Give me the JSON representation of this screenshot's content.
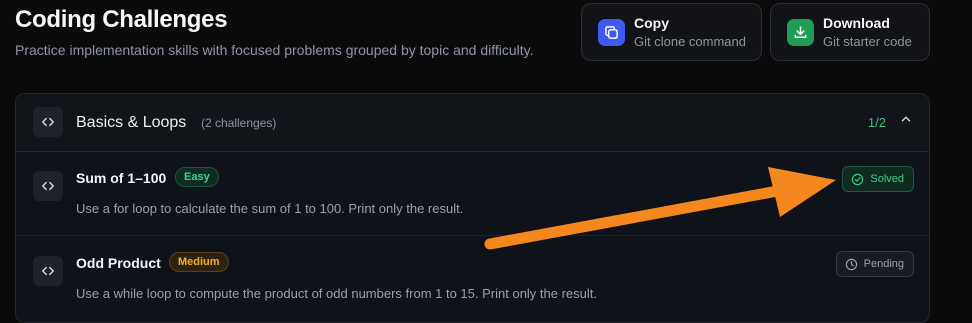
{
  "header": {
    "title": "Coding Challenges",
    "subtitle": "Practice implementation skills with focused problems grouped by topic and difficulty."
  },
  "actions": [
    {
      "label": "Copy",
      "sub": "Git clone command",
      "icon": "copy-icon",
      "color": "#3d5af1"
    },
    {
      "label": "Download",
      "sub": "Git starter code",
      "icon": "download-icon",
      "color": "#1f9d55"
    }
  ],
  "group": {
    "icon": "code-icon",
    "title": "Basics & Loops",
    "count": "(2 challenges)",
    "progress": "1/2",
    "expanded": true
  },
  "challenges": [
    {
      "name": "Sum of 1–100",
      "difficulty": "Easy",
      "description": "Use a for loop to calculate the sum of 1 to 100. Print only the result.",
      "status": "Solved"
    },
    {
      "name": "Odd Product",
      "difficulty": "Medium",
      "description": "Use a while loop to compute the product of odd numbers from 1 to 15. Print only the result.",
      "status": "Pending"
    }
  ],
  "annotation": {
    "type": "arrow",
    "color": "#f5871f"
  }
}
